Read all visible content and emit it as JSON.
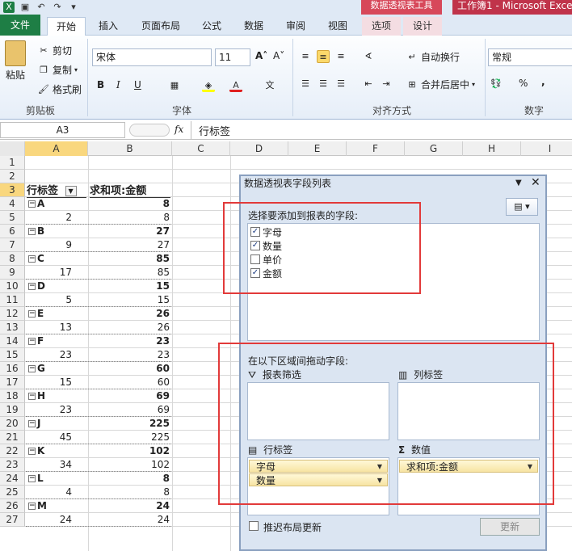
{
  "titlebar": {
    "pivot_tools": "数据透视表工具",
    "app_title": "工作簿1 - Microsoft Excel"
  },
  "tabs": [
    "文件",
    "开始",
    "插入",
    "页面布局",
    "公式",
    "数据",
    "审阅",
    "视图",
    "选项",
    "设计"
  ],
  "clipboard": {
    "paste": "粘贴",
    "cut": "剪切",
    "copy": "复制",
    "format_painter": "格式刷",
    "group": "剪贴板"
  },
  "font": {
    "name": "宋体",
    "size": "11",
    "bold": "B",
    "italic": "I",
    "underline": "U",
    "group": "字体"
  },
  "alignment": {
    "wrap": "自动换行",
    "merge": "合并后居中",
    "group": "对齐方式"
  },
  "number": {
    "format": "常规",
    "percent": "%",
    "comma": ",",
    "group": "数字"
  },
  "formula_bar": {
    "name_box": "A3",
    "fx": "fx",
    "content": "行标签"
  },
  "columns": [
    "A",
    "B",
    "C",
    "D",
    "E",
    "F",
    "G",
    "H",
    "I"
  ],
  "rows": [
    "1",
    "2",
    "3",
    "4",
    "5",
    "6",
    "7",
    "8",
    "9",
    "10",
    "11",
    "12",
    "13",
    "14",
    "15",
    "16",
    "17",
    "18",
    "19",
    "20",
    "21",
    "22",
    "23",
    "24",
    "25",
    "26",
    "27"
  ],
  "pivot": {
    "header_a": "行标签",
    "header_b": "求和项:金额",
    "groups": [
      {
        "letter": "A",
        "total": "8",
        "qty": "2",
        "value": "8"
      },
      {
        "letter": "B",
        "total": "27",
        "qty": "9",
        "value": "27"
      },
      {
        "letter": "C",
        "total": "85",
        "qty": "17",
        "value": "85"
      },
      {
        "letter": "D",
        "total": "15",
        "qty": "5",
        "value": "15"
      },
      {
        "letter": "E",
        "total": "26",
        "qty": "13",
        "value": "26"
      },
      {
        "letter": "F",
        "total": "23",
        "qty": "23",
        "value": "23"
      },
      {
        "letter": "G",
        "total": "60",
        "qty": "15",
        "value": "60"
      },
      {
        "letter": "H",
        "total": "69",
        "qty": "23",
        "value": "69"
      },
      {
        "letter": "J",
        "total": "225",
        "qty": "45",
        "value": "225"
      },
      {
        "letter": "K",
        "total": "102",
        "qty": "34",
        "value": "102"
      },
      {
        "letter": "L",
        "total": "8",
        "qty": "4",
        "value": "8"
      },
      {
        "letter": "M",
        "total": "24",
        "qty": "24",
        "value": "24"
      }
    ]
  },
  "panel": {
    "title": "数据透视表字段列表",
    "choose_label": "选择要添加到报表的字段:",
    "fields": [
      {
        "name": "字母",
        "checked": true
      },
      {
        "name": "数量",
        "checked": true
      },
      {
        "name": "单价",
        "checked": false
      },
      {
        "name": "金额",
        "checked": true
      }
    ],
    "drag_label": "在以下区域间拖动字段:",
    "report_filter": "报表筛选",
    "column_labels": "列标签",
    "row_labels": "行标签",
    "values": "数值",
    "row_items": [
      "字母",
      "数量"
    ],
    "value_items": [
      "求和项:金额"
    ],
    "defer_label": "推迟布局更新",
    "update_button": "更新"
  }
}
